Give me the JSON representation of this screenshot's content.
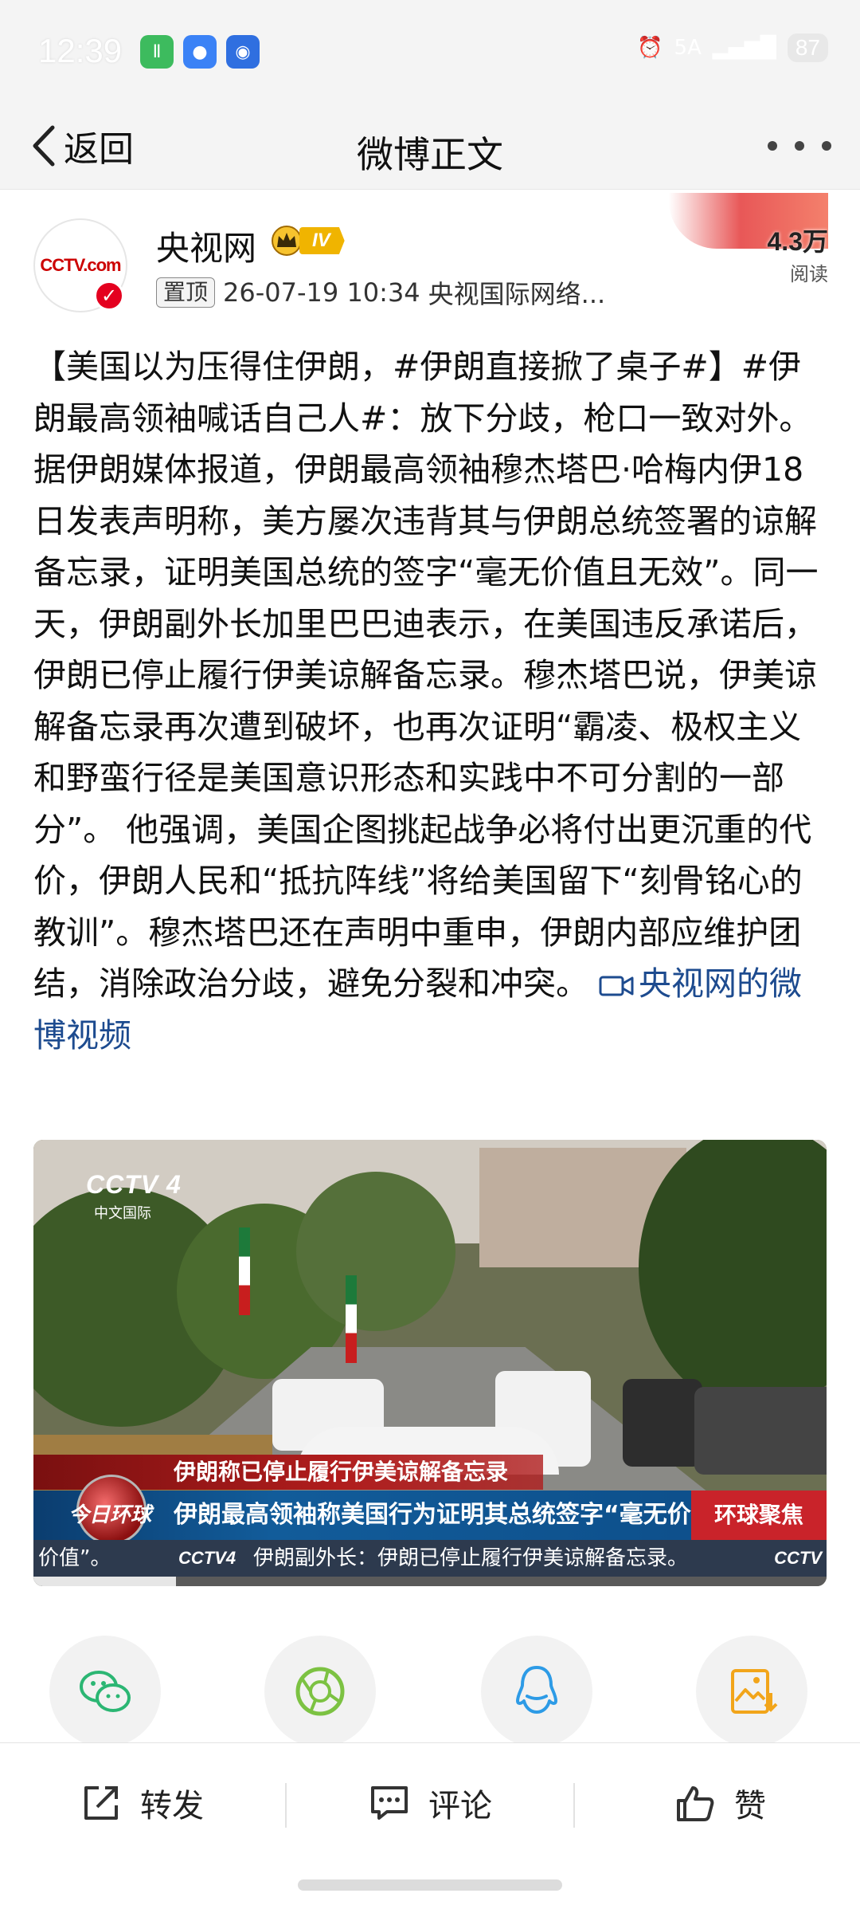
{
  "status_bar": {
    "time": "12:39",
    "network": "5A",
    "battery": "87",
    "app_icons": [
      "game-app-icon",
      "message-app-icon",
      "shield-app-icon"
    ]
  },
  "nav": {
    "back_label": "返回",
    "title": "微博正文"
  },
  "author": {
    "name": "央视网",
    "avatar_text": "CCTV.com",
    "vip_level": "IV",
    "pinned_label": "置顶",
    "timestamp": "26-07-19 10:34",
    "source": "央视国际网络...",
    "reads_value": "4.3万",
    "reads_label": "阅读"
  },
  "post": {
    "text": "【美国以为压得住伊朗，#伊朗直接掀了桌子#】#伊朗最高领袖喊话自己人#：放下分歧，枪口一致对外。据伊朗媒体报道，伊朗最高领袖穆杰塔巴·哈梅内伊18日发表声明称，美方屡次违背其与伊朗总统签署的谅解备忘录，证明美国总统的签字“毫无价值且无效”。同一天，伊朗副外长加里巴巴迪表示，在美国违反承诺后，伊朗已停止履行伊美谅解备忘录。穆杰塔巴说，伊美谅解备忘录再次遭到破坏，也再次证明“霸凌、极权主义和野蛮行径是美国意识形态和实践中不可分割的一部分”。 他强调，美国企图挑起战争必将付出更沉重的代价，伊朗人民和“抵抗阵线”将给美国留下“刻骨铭心的教训”。穆杰塔巴还在声明中重申，伊朗内部应维护团结，消除政治分歧，避免分裂和冲突。",
    "video_link_label": "央视网的微博视频"
  },
  "video": {
    "channel_logo": "CCTV 4",
    "channel_sub": "中文国际",
    "lower_third_1": "伊朗称已停止履行伊美谅解备忘录",
    "program_name": "今日环球",
    "lower_third_2": "伊朗最高领袖称美国行为证明其总统签字“毫无价值”",
    "segment": "环球聚焦",
    "ticker_left": "价值”。",
    "ticker_logo": "CCTV4",
    "ticker_text": "伊朗副外长：伊朗已停止履行伊美谅解备忘录。",
    "ticker_logo_right": "CCTV",
    "progress": 0.18
  },
  "share": [
    "wechat-icon",
    "moments-icon",
    "qq-icon",
    "save-image-icon"
  ],
  "actions": {
    "repost": "转发",
    "comment": "评论",
    "like": "赞"
  },
  "colors": {
    "background": "#ffffff",
    "bar_bg": "#f4f4f4",
    "vip_gold": "#f0b400",
    "verified_red": "#e4001f",
    "wechat_green": "#2bb673",
    "moments_green": "#7cc242",
    "qq_blue": "#2d9be6",
    "save_orange": "#f2a51a",
    "link_blue": "#1d4b8f"
  }
}
